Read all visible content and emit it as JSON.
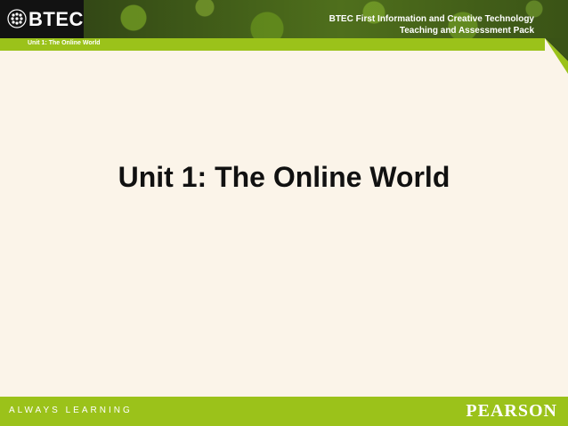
{
  "header": {
    "logo_text": "BTEC",
    "title_line1": "BTEC First Information and Creative Technology",
    "title_line2": "Teaching and Assessment Pack"
  },
  "subbar": {
    "label": "Unit 1: The Online World"
  },
  "main": {
    "title": "Unit 1: The Online World"
  },
  "footer": {
    "tagline": "ALWAYS LEARNING",
    "brand": "PEARSON"
  },
  "colors": {
    "accent_green": "#9bc21a",
    "background": "#fbf4e9",
    "logo_box": "#121212"
  }
}
